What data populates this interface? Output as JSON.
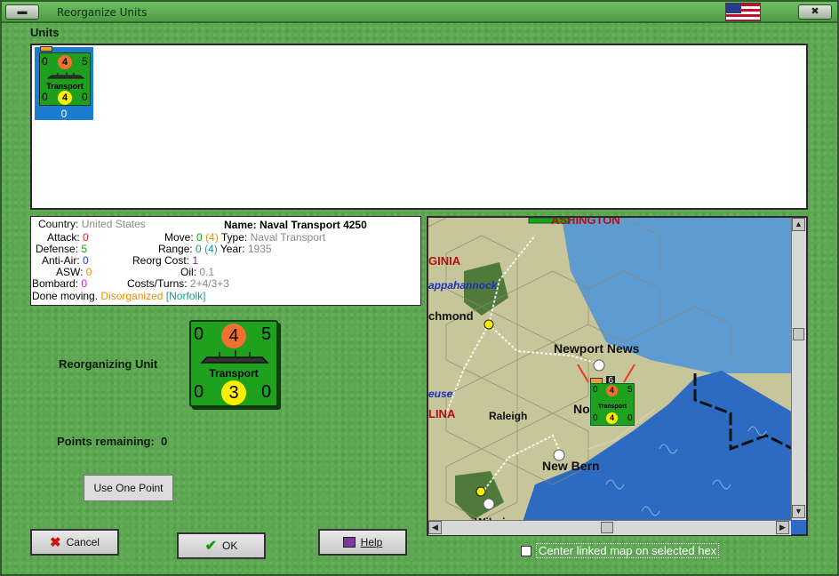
{
  "window": {
    "title": "Reorganize Units",
    "flag": "us-flag-icon"
  },
  "units": {
    "label": "Units",
    "selected_index": "0",
    "counter": {
      "top_left": "0",
      "top_mid": "4",
      "top_right": "5",
      "name": "Transport",
      "bot_left": "0",
      "bot_mid": "4",
      "bot_right": "0"
    }
  },
  "info": {
    "country_label": "Country:",
    "country_value": "United States",
    "name_label": "Name:",
    "name_value": "Naval Transport 4250",
    "attack_label": "Attack:",
    "attack_value": "0",
    "defense_label": "Defense:",
    "defense_value": "5",
    "antiair_label": "Anti-Air:",
    "antiair_value": "0",
    "asw_label": "ASW:",
    "asw_value": "0",
    "bombard_label": "Bombard:",
    "bombard_value": "0",
    "move_label": "Move:",
    "move_value": "0",
    "move_paren": "(4)",
    "range_label": "Range:",
    "range_value": "0",
    "range_paren": "(4)",
    "reorg_label": "Reorg Cost:",
    "reorg_value": "1",
    "oil_label": "Oil:",
    "oil_value": "0.1",
    "costs_label": "Costs/Turns:",
    "costs_value": "2+4/3+3",
    "type_label": "Type:",
    "type_value": "Naval Transport",
    "year_label": "Year:",
    "year_value": "1935",
    "status_done": "Done moving.",
    "status_disorg": "Disorganized",
    "status_loc": "[Norfolk]"
  },
  "reorg": {
    "label": "Reorganizing Unit",
    "counter": {
      "top_left": "0",
      "top_mid": "4",
      "top_right": "5",
      "name": "Transport",
      "bot_left": "0",
      "bot_mid": "3",
      "bot_right": "0"
    },
    "points_label": "Points remaining:",
    "points_value": "0",
    "use_point_label": "Use One Point"
  },
  "buttons": {
    "cancel": "Cancel",
    "ok": "OK",
    "help": "Help"
  },
  "map": {
    "labels": {
      "washington": "ASHINGTON",
      "virginia": "GINIA",
      "rappahannock": "appahannock",
      "richmond": "chmond",
      "newport_news": "Newport News",
      "neuse": "euse",
      "carolina": "LINA",
      "raleigh": "Raleigh",
      "norfolk": "No",
      "new_bern": "New Bern",
      "wilmington": "Wilmin"
    },
    "stack_count": "6",
    "map_counter": {
      "top_left": "0",
      "top_mid": "4",
      "top_right": "5",
      "name": "Transport",
      "bot_left": "0",
      "bot_mid": "4",
      "bot_right": "0"
    },
    "center_label": "Center linked map on selected hex"
  },
  "colors": {
    "window_green": "#5ca851",
    "counter_green": "#1fa01f",
    "attack_circle": "#f07030",
    "defense_circle": "#ffee00",
    "selection_blue": "#1c7ccf",
    "sea_blue": "#2d6bc2"
  }
}
